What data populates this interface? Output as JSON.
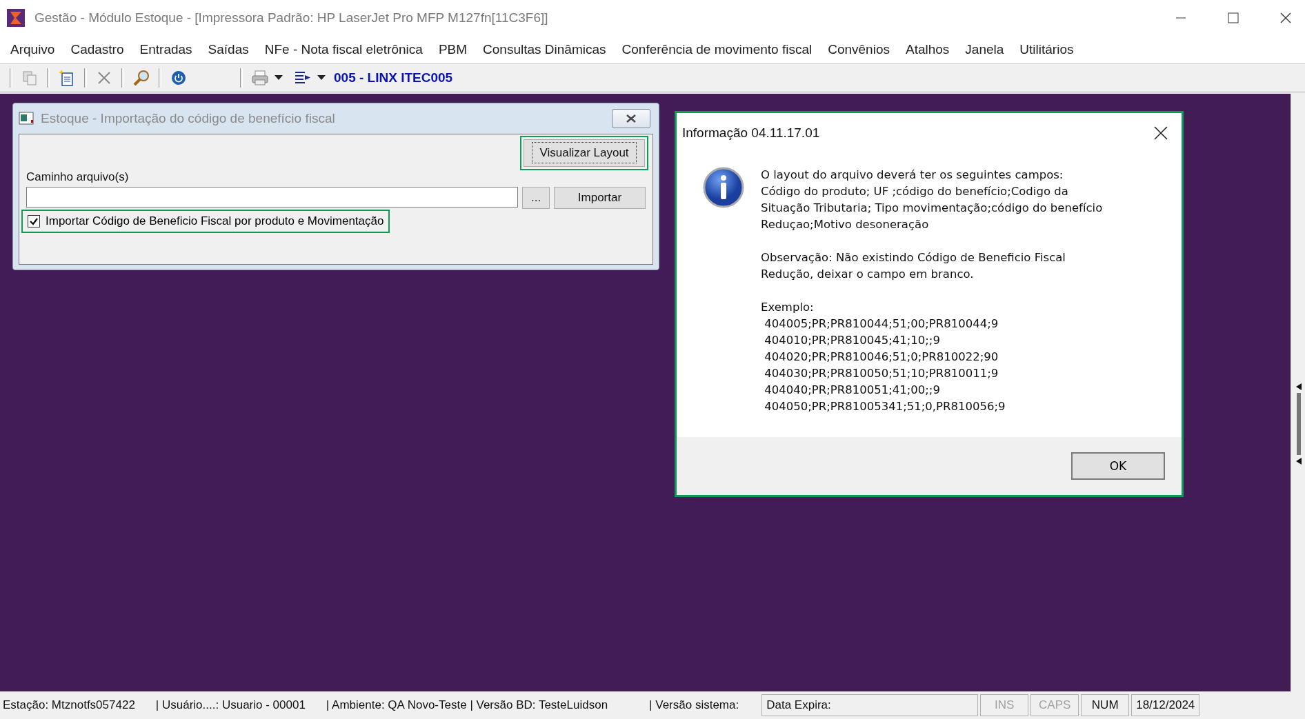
{
  "window": {
    "title": "Gestão  - Módulo Estoque - [Impressora Padrão: HP LaserJet Pro MFP M127fn[11C3F6]]"
  },
  "menu": [
    "Arquivo",
    "Cadastro",
    "Entradas",
    "Saídas",
    "NFe - Nota fiscal eletrônica",
    "PBM",
    "Consultas Dinâmicas",
    "Conferência de movimento fiscal",
    "Convênios",
    "Atalhos",
    "Janela",
    "Utilitários"
  ],
  "toolbar": {
    "company": "005 - LINX ITEC005"
  },
  "import_dialog": {
    "title": "Estoque - Importação do código de benefício fiscal",
    "layout_button": {
      "label": "Visualizar Layout",
      "highlighted": true
    },
    "path_label": "Caminho arquivo(s)",
    "browse_button": "...",
    "import_button": "Importar",
    "checkbox": {
      "label": "Importar Código de Beneficio Fiscal por produto e Movimentação",
      "checked": true,
      "highlighted": true
    }
  },
  "info_dialog": {
    "title": "Informação 04.11.17.01",
    "highlighted": true,
    "paragraphs": [
      "O layout do arquivo deverá ter os seguintes campos:\nCódigo do produto; UF ;código do benefício;Codigo da\nSituação Tributaria; Tipo movimentação;código do benefício\nReduçao;Motivo desoneração",
      "Observação: Não existindo Código de Beneficio Fiscal\nRedução, deixar o campo em branco.",
      "Exemplo:\n 404005;PR;PR810044;51;00;PR810044;9\n 404010;PR;PR810045;41;10;;9\n 404020;PR;PR810046;51;0;PR810022;90\n 404030;PR;PR810050;51;10;PR810011;9\n 404040;PR;PR810051;41;00;;9\n 404050;PR;PR81005341;51;0,PR810056;9"
    ],
    "ok_button": "OK"
  },
  "status_bar": {
    "segments": [
      "Estação: Mtznotfs057422",
      "| Usuário....: Usuario - 00001",
      "| Ambiente: QA Novo-Teste | Versão BD: TesteLuidson",
      "| Versão sistema:"
    ],
    "panels": [
      {
        "kind": "field",
        "label": "Data Expira:"
      },
      {
        "kind": "key",
        "label": "INS",
        "on": false
      },
      {
        "kind": "key",
        "label": "CAPS",
        "on": false
      },
      {
        "kind": "key",
        "label": "NUM",
        "on": true
      },
      {
        "kind": "field",
        "label": "18/12/2024"
      }
    ]
  }
}
